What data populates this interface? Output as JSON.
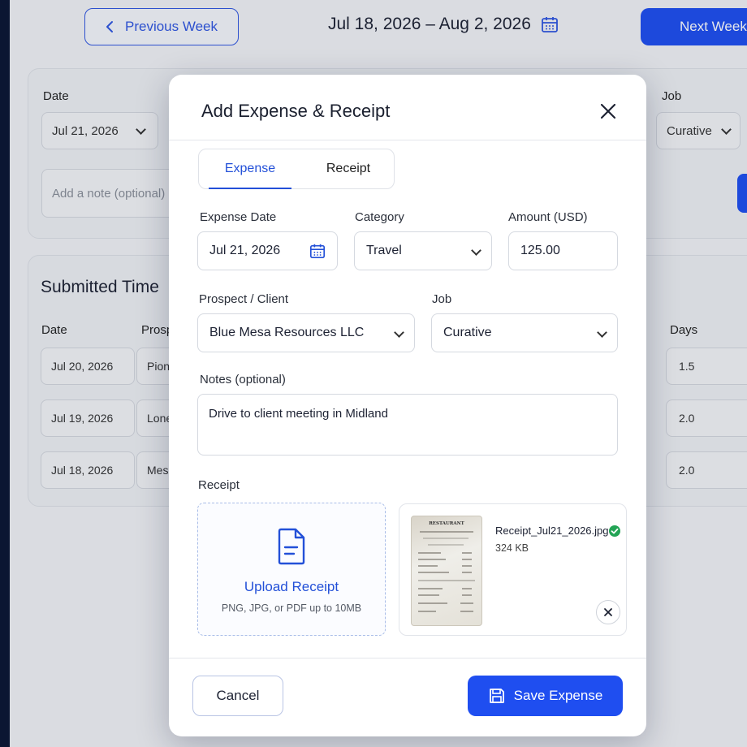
{
  "header": {
    "prev_label": "Previous Week",
    "week_range": "Jul 18, 2026 – Aug 2, 2026",
    "next_label": "Next Week"
  },
  "entry_form": {
    "date_label": "Date",
    "date_value": "Jul 21, 2026",
    "job_label": "Job",
    "job_value": "Curative",
    "note_placeholder": "Add a note (optional)"
  },
  "submitted": {
    "title": "Submitted Time",
    "columns": [
      "Date",
      "Prosp",
      "Days"
    ],
    "rows": [
      {
        "date": "Jul 20, 2026",
        "prospect": "Pion",
        "days": "1.5"
      },
      {
        "date": "Jul 19, 2026",
        "prospect": "Lone",
        "days": "2.0"
      },
      {
        "date": "Jul 18, 2026",
        "prospect": "Mes",
        "days": "2.0"
      }
    ]
  },
  "modal": {
    "title": "Add Expense & Receipt",
    "tabs": [
      {
        "label": "Expense",
        "active": true
      },
      {
        "label": "Receipt",
        "active": false
      }
    ],
    "expense_date_label": "Expense Date",
    "expense_date_value": "Jul 21, 2026",
    "category_label": "Category",
    "category_value": "Travel",
    "amount_label": "Amount (USD)",
    "amount_value": "125.00",
    "client_label": "Prospect / Client",
    "client_value": "Blue Mesa Resources LLC",
    "job_label": "Job",
    "job_value": "Curative",
    "notes_label": "Notes (optional)",
    "notes_value": "Drive to client meeting in Midland",
    "receipt_label": "Receipt",
    "upload_title": "Upload Receipt",
    "upload_hint": "PNG, JPG, or PDF up to 10MB",
    "file_name": "Receipt_Jul21_2026.jpg",
    "file_size": "324 KB",
    "thumb_heading": "RESTAURANT",
    "cancel_label": "Cancel",
    "save_label": "Save Expense"
  },
  "colors": {
    "accent": "#1f4ef0",
    "success": "#23a455",
    "sidebar": "#0b1633"
  }
}
